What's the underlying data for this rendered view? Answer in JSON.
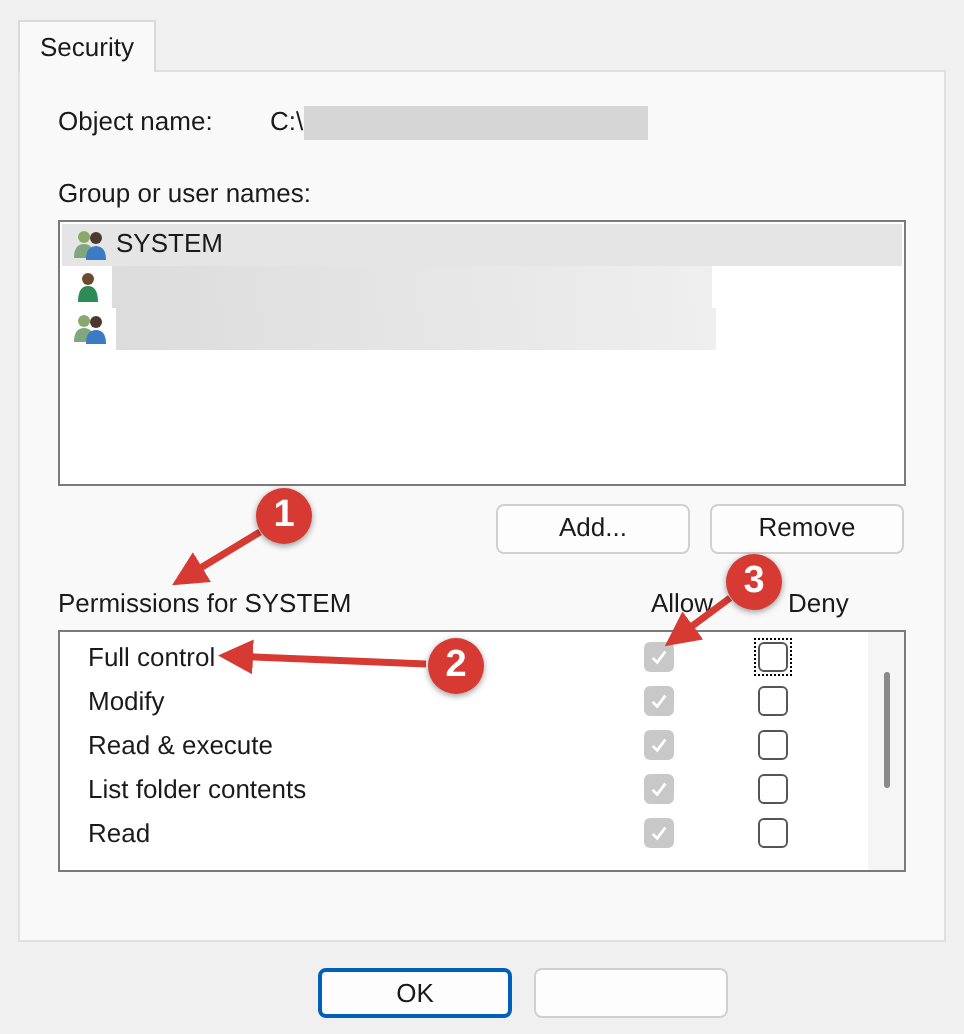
{
  "tabs": [
    {
      "label": "Security",
      "selected": true
    }
  ],
  "object_name": {
    "label": "Object name:",
    "value": "C:\\"
  },
  "group_list": {
    "label": "Group or user names:",
    "items": [
      {
        "name": "SYSTEM",
        "kind": "group",
        "selected": true
      },
      {
        "kind": "user",
        "selected": false,
        "redacted": true
      },
      {
        "kind": "group",
        "selected": false,
        "redacted": true
      }
    ]
  },
  "buttons": [
    "Add...",
    "Remove"
  ],
  "permissions": {
    "label": "Permissions for SYSTEM",
    "columns": [
      "Allow",
      "Deny"
    ],
    "rows": [
      {
        "name": "Full control",
        "allow": true,
        "deny": false,
        "focused": true
      },
      {
        "name": "Modify",
        "allow": true,
        "deny": false,
        "focused": false
      },
      {
        "name": "Read & execute",
        "allow": true,
        "deny": false,
        "focused": false
      },
      {
        "name": "List folder contents",
        "allow": true,
        "deny": false,
        "focused": false
      },
      {
        "name": "Read",
        "allow": true,
        "deny": false,
        "focused": false
      }
    ],
    "allow_disabled": true
  },
  "dialog_buttons": [
    {
      "label": "OK",
      "default": true
    },
    {
      "default": false
    }
  ],
  "annotations": [
    {
      "label": "1"
    },
    {
      "label": "2"
    },
    {
      "label": "3"
    }
  ]
}
